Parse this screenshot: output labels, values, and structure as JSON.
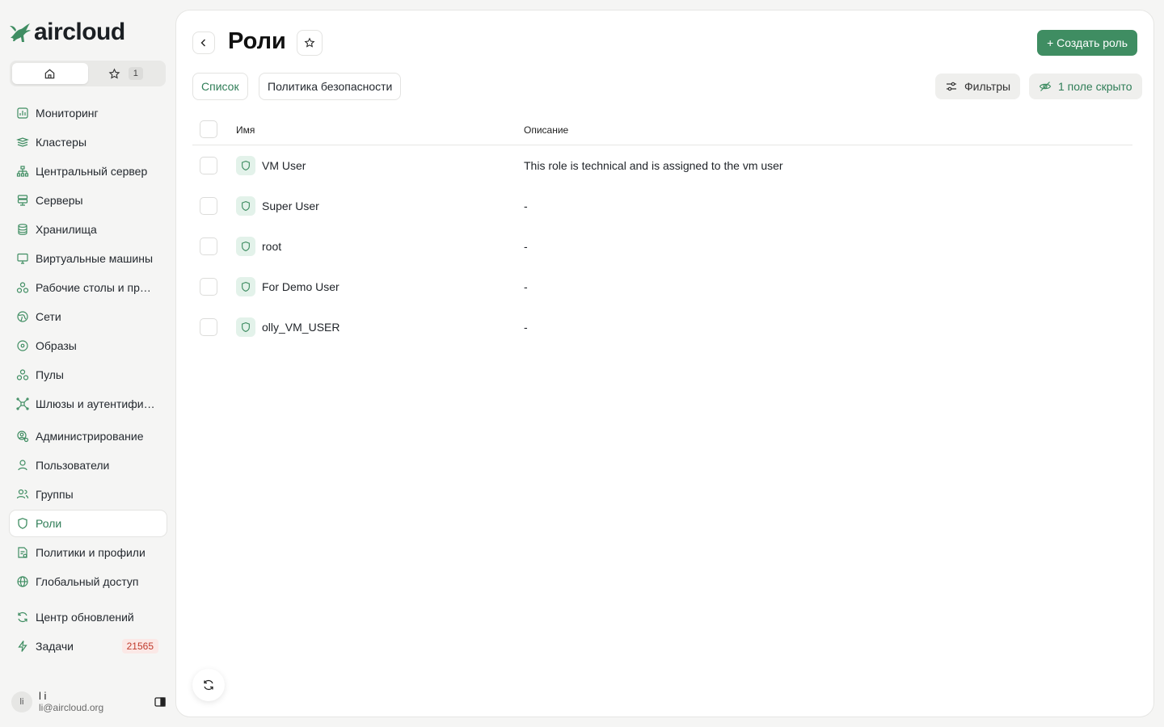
{
  "brand": {
    "name": "aircloud",
    "color": "#3f8d62"
  },
  "quick_tabs": {
    "home_icon": "home-icon",
    "favorites_icon": "star-icon",
    "favorites_count": "1"
  },
  "sidebar": {
    "items": [
      {
        "label": "Мониторинг",
        "icon": "chart-icon"
      },
      {
        "label": "Кластеры",
        "icon": "layers-icon"
      },
      {
        "label": "Центральный сервер",
        "icon": "hierarchy-icon"
      },
      {
        "label": "Серверы",
        "icon": "server-icon"
      },
      {
        "label": "Хранилища",
        "icon": "database-icon"
      },
      {
        "label": "Виртуальные машины",
        "icon": "monitor-icon"
      },
      {
        "label": "Рабочие столы и прил...",
        "icon": "apps-icon"
      },
      {
        "label": "Сети",
        "icon": "globe-net-icon"
      },
      {
        "label": "Образы",
        "icon": "disc-icon"
      },
      {
        "label": "Пулы",
        "icon": "pool-icon"
      },
      {
        "label": "Шлюзы и аутентифика...",
        "icon": "gateway-icon"
      },
      {
        "label": "Администрирование",
        "icon": "admin-icon"
      },
      {
        "label": "Пользователи",
        "icon": "user-icon"
      },
      {
        "label": "Группы",
        "icon": "group-icon"
      },
      {
        "label": "Роли",
        "icon": "shield-icon"
      },
      {
        "label": "Политики и профили",
        "icon": "policy-icon"
      },
      {
        "label": "Глобальный доступ",
        "icon": "globe-icon"
      },
      {
        "label": "Центр обновлений",
        "icon": "refresh-icon"
      },
      {
        "label": "Задачи",
        "icon": "lightning-icon",
        "badge": "21565"
      }
    ]
  },
  "user": {
    "initials": "li",
    "name": "l i",
    "email": "li@aircloud.org"
  },
  "page": {
    "title": "Роли",
    "create_label": "+ Создать роль",
    "tabs": [
      "Список",
      "Политика безопасности"
    ],
    "filters_label": "Фильтры",
    "hidden_fields_label": "1 поле скрыто"
  },
  "table": {
    "columns": [
      "Имя",
      "Описание"
    ],
    "rows": [
      {
        "name": "VM User",
        "description": "This role is technical and is assigned to the vm user"
      },
      {
        "name": "Super User",
        "description": "-"
      },
      {
        "name": "root",
        "description": "-"
      },
      {
        "name": "For Demo User",
        "description": "-"
      },
      {
        "name": "olly_VM_USER",
        "description": "-"
      }
    ]
  }
}
